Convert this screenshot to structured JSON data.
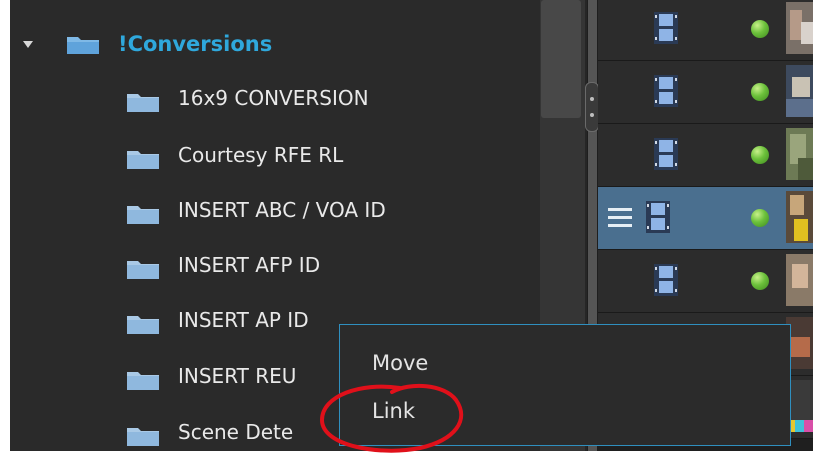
{
  "tree": {
    "root": {
      "label": "!Conversions",
      "expanded": true,
      "icon": "folder-icon"
    },
    "children": [
      {
        "label": "16x9 CONVERSION"
      },
      {
        "label": "Courtesy RFE RL"
      },
      {
        "label": "INSERT ABC / VOA ID"
      },
      {
        "label": "INSERT AFP ID"
      },
      {
        "label": "INSERT AP ID"
      },
      {
        "label": "INSERT REU"
      },
      {
        "label": "Scene Dete"
      }
    ]
  },
  "list": {
    "rows": [
      {
        "selected": false,
        "icon": "film-icon",
        "status": "green-led"
      },
      {
        "selected": false,
        "icon": "film-icon",
        "status": "green-led"
      },
      {
        "selected": false,
        "icon": "film-icon",
        "status": "green-led"
      },
      {
        "selected": true,
        "icon": "film-icon",
        "status": "green-led",
        "menu_icon": "hamburger-icon"
      },
      {
        "selected": false,
        "icon": "film-icon",
        "status": "green-led"
      },
      {
        "selected": false,
        "icon": "film-icon",
        "status": "green-led"
      },
      {
        "selected": false,
        "icon": "film-icon",
        "status": "green-led"
      }
    ]
  },
  "context_menu": {
    "items": [
      {
        "label": "Move"
      },
      {
        "label": "Link"
      }
    ]
  },
  "colors": {
    "accent": "#2fa8dc",
    "selected_row": "#4a6f8f",
    "annotation": "#e0101a",
    "menu_border": "#2f8fbf"
  }
}
